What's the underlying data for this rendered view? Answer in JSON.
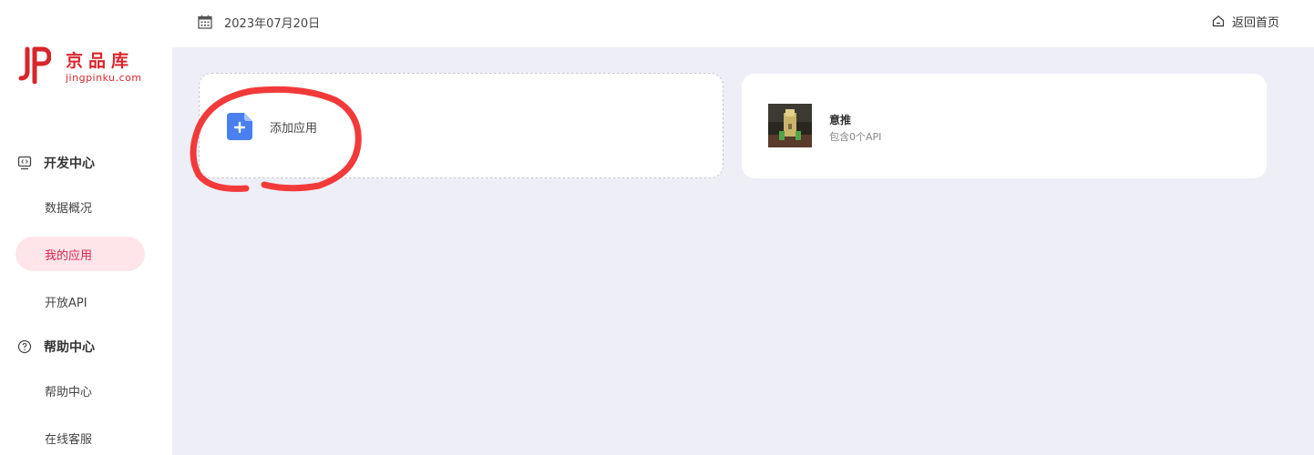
{
  "brand": {
    "title": "京品库",
    "subtitle": "jingpinku.com",
    "color": "#d9262c"
  },
  "header": {
    "date": "2023年07月20日",
    "home_label": "返回首页"
  },
  "sidebar": {
    "sections": [
      {
        "label": "开发中心",
        "icon": "code-monitor-icon",
        "items": [
          {
            "label": "数据概况",
            "active": false
          },
          {
            "label": "我的应用",
            "active": true
          },
          {
            "label": "开放API",
            "active": false
          }
        ]
      },
      {
        "label": "帮助中心",
        "icon": "question-circle-icon",
        "items": [
          {
            "label": "帮助中心",
            "active": false
          },
          {
            "label": "在线客服",
            "active": false
          }
        ]
      }
    ]
  },
  "main": {
    "add_card": {
      "label": "添加应用",
      "icon": "add-document-icon"
    },
    "apps": [
      {
        "name": "意推",
        "api_count": "包含0个API"
      }
    ]
  },
  "colors": {
    "accent": "#e0224c",
    "active_bg": "#fde5ea",
    "main_bg": "#eeeef7",
    "add_icon": "#4a7ff0",
    "annotation": "#f23a3a"
  }
}
